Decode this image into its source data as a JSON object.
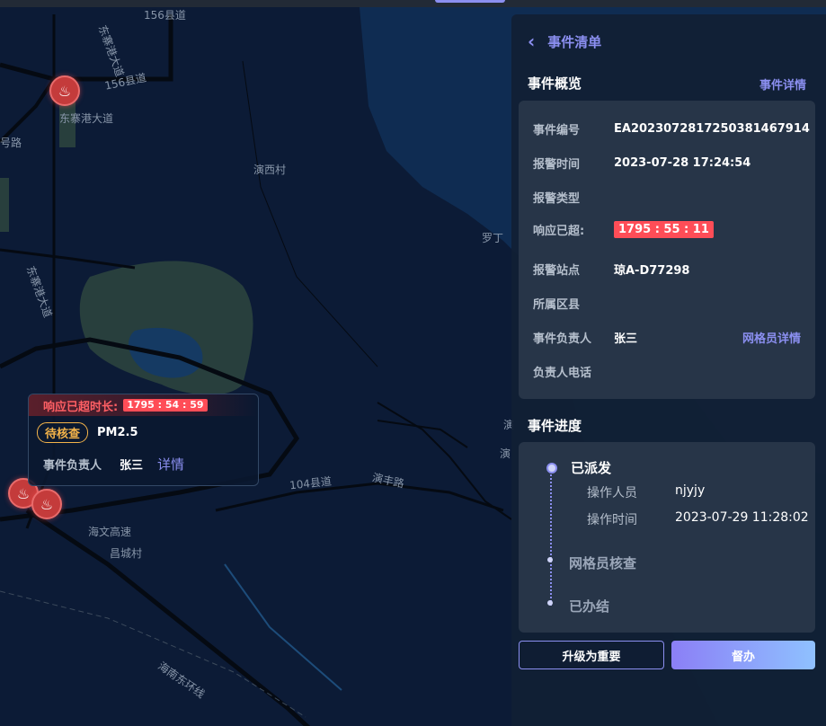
{
  "map": {
    "labels": [
      "156县道",
      "156县道",
      "东寨港大道",
      "东寨港大道",
      "东寨港大道",
      "号路",
      "演西村",
      "罗丁",
      "104县道",
      "演丰路",
      "海文高速",
      "昌城村",
      "海南东环线",
      "演",
      "演"
    ],
    "marker_glyph": "♨",
    "marker_icon": "alarm-marker-icon"
  },
  "popup": {
    "header_label": "响应已超时长:",
    "timer": "1795 : 54 : 59",
    "status_tag": "待核查",
    "pollutant": "PM2.5",
    "owner_label": "事件负责人",
    "owner_value": "张三",
    "details_link": "详情"
  },
  "panel": {
    "back_icon": "chevron-left-icon",
    "back_glyph": "‹",
    "title": "事件清单",
    "overview_title": "事件概览",
    "overview_link": "事件详情",
    "info": {
      "event_no_label": "事件编号",
      "event_no": "EA2023072817250381467914",
      "alarm_time_label": "报警时间",
      "alarm_time": "2023-07-28 17:24:54",
      "alarm_type_label": "报警类型",
      "response_label": "响应已超:",
      "response_timer": "1795 : 55 : 11",
      "station_label": "报警站点",
      "station": "琼A-D77298",
      "county_label": "所属区县",
      "owner_label": "事件负责人",
      "owner": "张三",
      "grid_link": "网格员详情",
      "phone_label": "负责人电话"
    },
    "progress_title": "事件进度",
    "progress": {
      "step1": "已派发",
      "operator_label": "操作人员",
      "operator": "njyjy",
      "op_time_label": "操作时间",
      "op_time": "2023-07-29 11:28:02",
      "step2": "网格员核查",
      "step3": "已办结"
    },
    "buttons": {
      "escalate": "升级为重要",
      "supervise": "督办"
    }
  },
  "colors": {
    "accent": "#8b8ff0",
    "alert": "#ff4d57",
    "panel_bg": "#111f34",
    "card_bg": "#273548",
    "map_bg": "#0b1a33"
  }
}
